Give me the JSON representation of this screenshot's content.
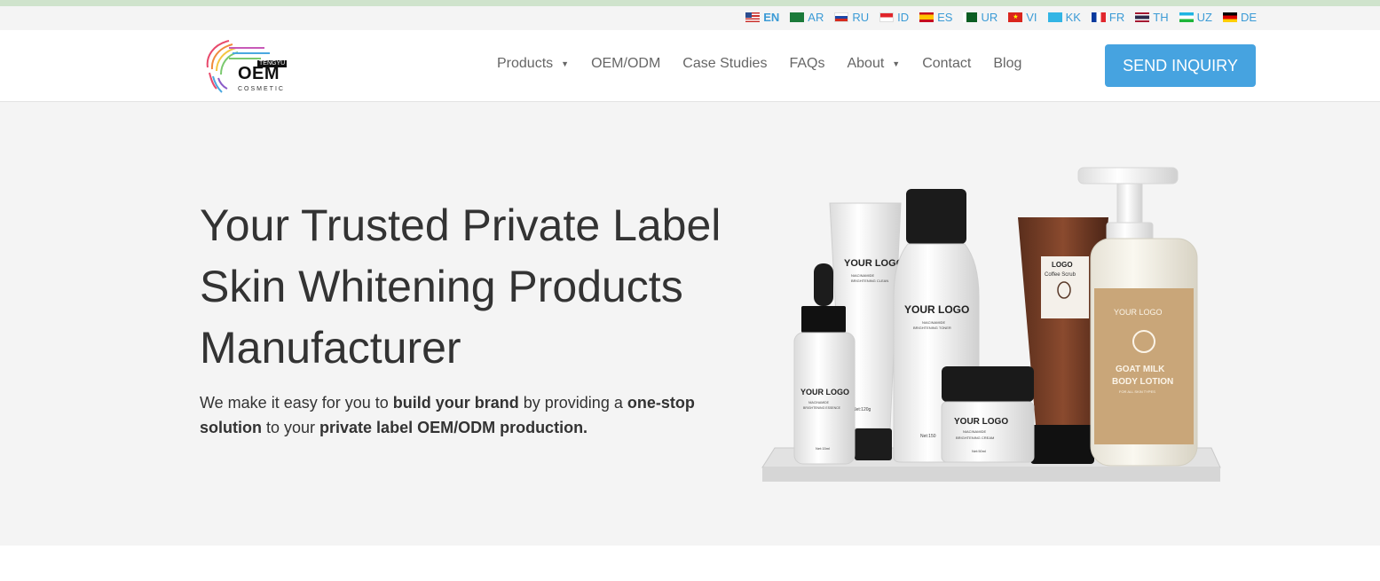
{
  "languages": [
    {
      "code": "EN"
    },
    {
      "code": "AR"
    },
    {
      "code": "RU"
    },
    {
      "code": "ID"
    },
    {
      "code": "ES"
    },
    {
      "code": "UR"
    },
    {
      "code": "VI"
    },
    {
      "code": "KK"
    },
    {
      "code": "FR"
    },
    {
      "code": "TH"
    },
    {
      "code": "UZ"
    },
    {
      "code": "DE"
    }
  ],
  "logo": {
    "brand": "TENGYU",
    "main": "OEM",
    "sub": "COSMETIC"
  },
  "nav": {
    "products": "Products",
    "oem_odm": "OEM/ODM",
    "case_studies": "Case Studies",
    "faqs": "FAQs",
    "about": "About",
    "contact": "Contact",
    "blog": "Blog"
  },
  "cta": {
    "label": "SEND INQUIRY"
  },
  "hero": {
    "title": "Your Trusted Private Label Skin Whitening Products Manufacturer",
    "text_1": "We make it easy for you to ",
    "text_bold_1": "build your brand",
    "text_2": " by providing a ",
    "text_bold_2": "one-stop solution",
    "text_3": " to your ",
    "text_bold_3": "private label OEM/ODM production."
  },
  "product_labels": {
    "dropper_logo": "YOUR LOGO",
    "dropper_sub": "NIACINAMIDE",
    "dropper_name": "BRIGHTENING ESSENCE",
    "dropper_net": "Net:15ml",
    "tube_logo": "YOUR LOGO",
    "tube_sub": "NIACINAMIDE",
    "tube_name": "BRIGHTENING CLEAN",
    "tube_net": "Net:120g",
    "toner_logo": "YOUR LOGO",
    "toner_sub": "NIACINAMIDE",
    "toner_name": "BRIGHTENING TONER",
    "toner_net": "Net:150",
    "jar_logo": "YOUR LOGO",
    "jar_sub": "NIACINAMIDE",
    "jar_name": "BRIGHTENING CREAM",
    "jar_net": "Net:50ml",
    "scrub_logo": "LOGO",
    "scrub_name": "Coffee Scrub",
    "lotion_logo": "YOUR LOGO",
    "lotion_name_1": "GOAT MILK",
    "lotion_name_2": "BODY LOTION",
    "lotion_sub": "FOR ALL SKIN TYPES"
  },
  "colors": {
    "accent": "#46a3e0",
    "lang_link": "#3b9bd6",
    "hero_bg": "#f4f4f4"
  }
}
